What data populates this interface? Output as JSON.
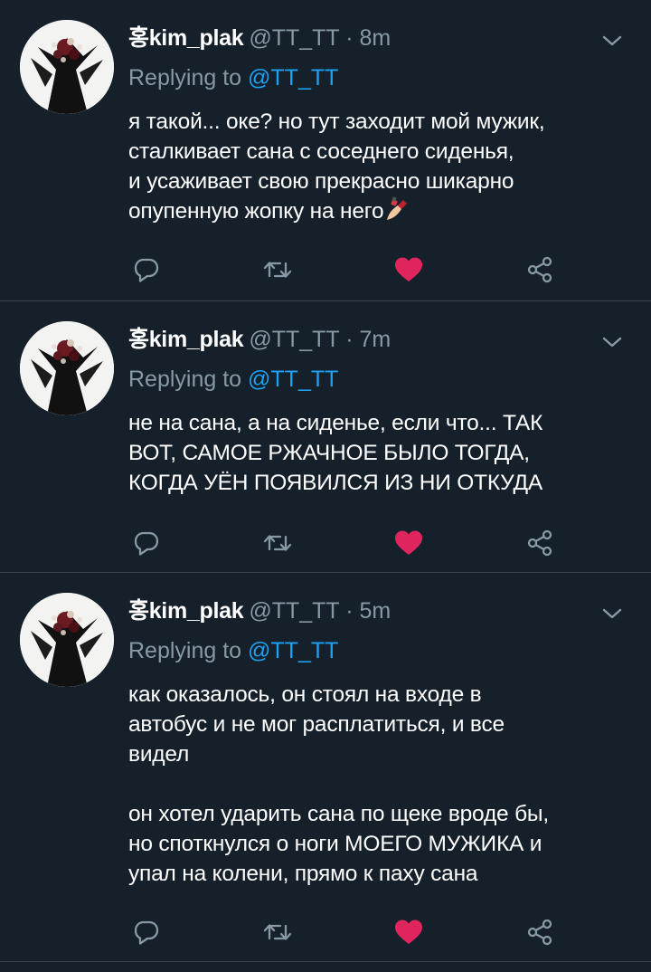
{
  "tweets": [
    {
      "name": "홍kim_plak",
      "handle": "@TT_TT",
      "dot": "·",
      "time": "8m",
      "replying_prefix": "Replying to",
      "replying_to": "@TT_TT",
      "lines": [
        "я такой... оке? но тут заходит мой мужик,",
        "сталкивает сана с соседнего сиденья,",
        "и усаживает свою прекрасно шикарно",
        "опупенную жопку на него"
      ],
      "emoji": "nail-polish-icon",
      "liked": true
    },
    {
      "name": "홍kim_plak",
      "handle": "@TT_TT",
      "dot": "·",
      "time": "7m",
      "replying_prefix": "Replying to",
      "replying_to": "@TT_TT",
      "lines": [
        "не на сана, а на сиденье, если что... ТАК",
        "ВОТ, САМОЕ РЖАЧНОЕ БЫЛО ТОГДА,",
        "КОГДА УЁН ПОЯВИЛСЯ ИЗ НИ ОТКУДА"
      ],
      "liked": true
    },
    {
      "name": "홍kim_plak",
      "handle": "@TT_TT",
      "dot": "·",
      "time": "5m",
      "replying_prefix": "Replying to",
      "replying_to": "@TT_TT",
      "lines": [
        "как оказалось, он стоял на входе в",
        "автобус и не мог расплатиться, и все",
        "видел"
      ],
      "lines2": [
        "он хотел ударить сана по щеке вроде бы,",
        "но споткнулся о ноги МОЕГО МУЖИКА и",
        "упал на колени, прямо к паху сана"
      ],
      "liked": true
    }
  ],
  "colors": {
    "background": "#15202b",
    "divider": "#38444d",
    "secondary_text": "#8899a6",
    "link": "#1da1f2",
    "like": "#e0245e"
  },
  "icons": {
    "reply": "reply-icon",
    "retweet": "retweet-icon",
    "like": "heart-icon",
    "share": "share-icon",
    "menu": "chevron-down-icon"
  }
}
